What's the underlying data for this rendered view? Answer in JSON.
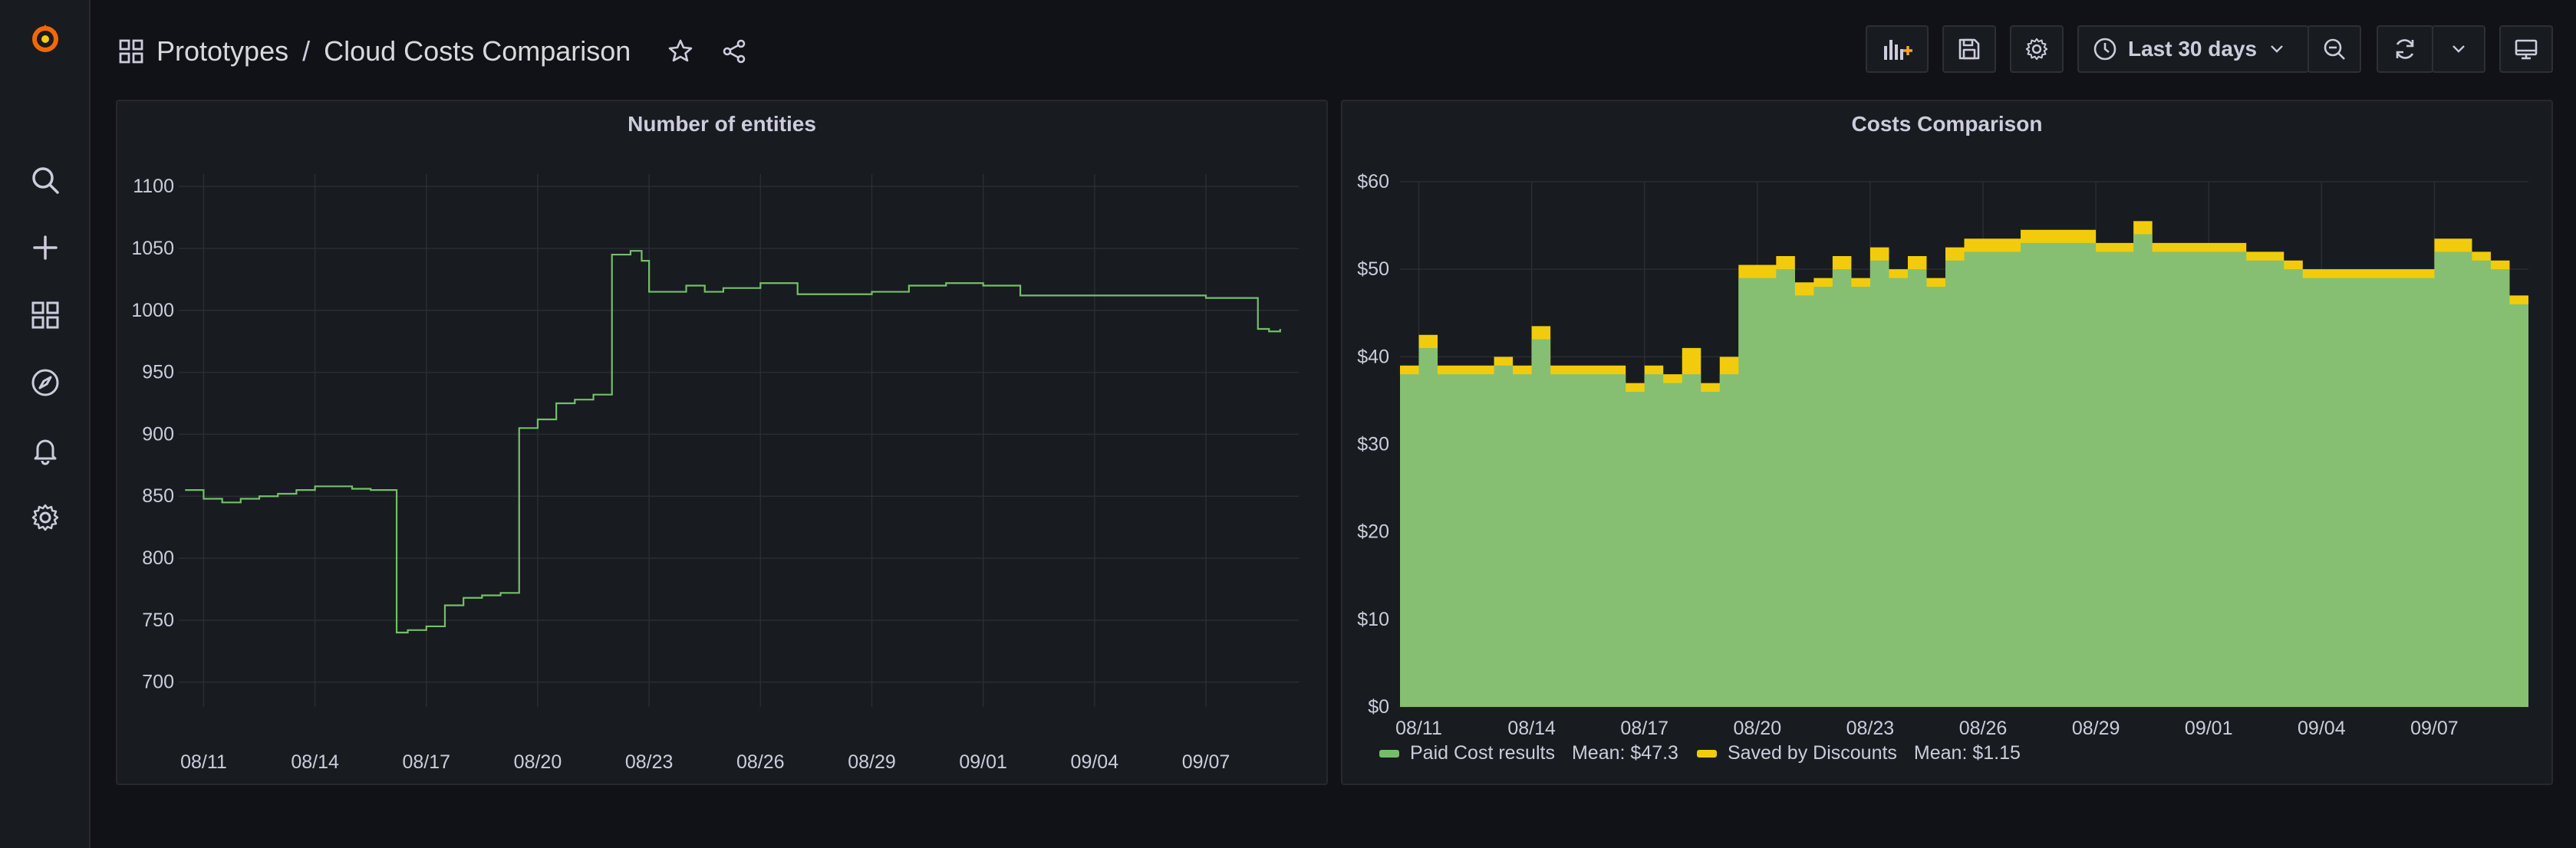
{
  "breadcrumb": {
    "folder": "Prototypes",
    "separator": "/",
    "dashboard": "Cloud Costs Comparison"
  },
  "toolbar": {
    "time_range": "Last 30 days"
  },
  "sidebar": {
    "items": [
      "grafana-logo-icon",
      "search-icon",
      "plus-icon",
      "dashboards-icon",
      "explore-icon",
      "alerting-bell-icon",
      "settings-gear-icon"
    ]
  },
  "colors": {
    "background": "#111217",
    "panel": "#181b1f",
    "green": "#73bf69",
    "area_green": "#86bf71",
    "yellow": "#f2cc0c",
    "logo": "#f46800"
  },
  "panels": [
    {
      "title": "Number of entities"
    },
    {
      "title": "Costs Comparison",
      "legend": [
        {
          "name": "Paid Cost results",
          "mean": "Mean: $47.3",
          "color": "#73bf69"
        },
        {
          "name": "Saved by Discounts",
          "mean": "Mean: $1.15",
          "color": "#f2cc0c"
        }
      ]
    }
  ],
  "chart_data": [
    {
      "type": "line",
      "title": "Number of entities",
      "x_ticks": [
        "08/11",
        "08/14",
        "08/17",
        "08/20",
        "08/23",
        "08/26",
        "08/29",
        "09/01",
        "09/04",
        "09/07"
      ],
      "y_ticks": [
        700,
        750,
        800,
        850,
        900,
        950,
        1000,
        1050,
        1100
      ],
      "ylim": [
        680,
        1110
      ],
      "xlim": [
        "08/10 08:00",
        "09/09 12:00"
      ],
      "grid": true,
      "series": [
        {
          "color": "#73bf69",
          "x_days": [
            10.5,
            11,
            11.5,
            12,
            12.5,
            13,
            13.5,
            14,
            14.5,
            15,
            15.5,
            16,
            16.2,
            16.5,
            17,
            17.5,
            18,
            18.5,
            19,
            19.5,
            20,
            20.5,
            21,
            21.5,
            22,
            22.5,
            22.8,
            23,
            23.5,
            24,
            24.5,
            25,
            26,
            27,
            28,
            29,
            30,
            31,
            32,
            33,
            34,
            35,
            36,
            37,
            38,
            39,
            39.4,
            39.7,
            40
          ],
          "y": [
            855,
            848,
            845,
            848,
            850,
            852,
            855,
            858,
            858,
            856,
            855,
            855,
            740,
            742,
            745,
            762,
            768,
            770,
            772,
            905,
            912,
            925,
            928,
            932,
            1045,
            1048,
            1040,
            1015,
            1015,
            1020,
            1015,
            1018,
            1022,
            1013,
            1013,
            1015,
            1020,
            1022,
            1020,
            1012,
            1012,
            1012,
            1012,
            1012,
            1010,
            1010,
            985,
            983,
            985
          ]
        }
      ]
    },
    {
      "type": "area",
      "title": "Costs Comparison",
      "x_ticks": [
        "08/11",
        "08/14",
        "08/17",
        "08/20",
        "08/23",
        "08/26",
        "08/29",
        "09/01",
        "09/04",
        "09/07"
      ],
      "y_ticks": [
        "$0",
        "$10",
        "$20",
        "$30",
        "$40",
        "$50",
        "$60"
      ],
      "ylim": [
        0,
        60
      ],
      "xlim": [
        "08/10 12:00",
        "09/09 12:00"
      ],
      "grid": true,
      "legend_position": "bottom",
      "series": [
        {
          "name": "Paid Cost results",
          "color": "#86bf71",
          "x_days": [
            10.5,
            11,
            11.5,
            12,
            12.5,
            13,
            13.5,
            14,
            14.5,
            15,
            15.5,
            16,
            16.5,
            17,
            17.5,
            18,
            18.5,
            19,
            19.5,
            20,
            20.5,
            21,
            21.5,
            22,
            22.5,
            23,
            23.5,
            24,
            24.5,
            25,
            25.5,
            26,
            27,
            28,
            29,
            30,
            30.5,
            31,
            32,
            33,
            34,
            34.5,
            35,
            36,
            37,
            38,
            39,
            39.5,
            40
          ],
          "y": [
            38,
            41,
            38,
            38,
            38,
            39,
            38,
            42,
            38,
            38,
            38,
            38,
            36,
            38,
            37,
            38,
            36,
            38,
            49,
            49,
            50,
            47,
            48,
            50,
            48,
            51,
            49,
            50,
            48,
            51,
            52,
            52,
            53,
            53,
            52,
            54,
            52,
            52,
            52,
            51,
            50,
            49,
            49,
            49,
            49,
            52,
            51,
            50,
            46
          ]
        },
        {
          "name": "Saved by Discounts",
          "color": "#f2cc0c",
          "x_days": [
            10.5,
            11,
            11.5,
            12,
            12.5,
            13,
            13.5,
            14,
            14.5,
            15,
            15.5,
            16,
            16.5,
            17,
            17.5,
            18,
            18.5,
            19,
            19.5,
            20,
            20.5,
            21,
            21.5,
            22,
            22.5,
            23,
            23.5,
            24,
            24.5,
            25,
            25.5,
            26,
            27,
            28,
            29,
            30,
            30.5,
            31,
            32,
            33,
            34,
            34.5,
            35,
            36,
            37,
            38,
            39,
            39.5,
            40
          ],
          "y": [
            1,
            1.5,
            1,
            1,
            1,
            1,
            1,
            1.5,
            1,
            1,
            1,
            1,
            1,
            1,
            1,
            3,
            1,
            2,
            1.5,
            1.5,
            1.5,
            1.5,
            1,
            1.5,
            1,
            1.5,
            1,
            1.5,
            1,
            1.5,
            1.5,
            1.5,
            1.5,
            1.5,
            1,
            1.5,
            1,
            1,
            1,
            1,
            1,
            1,
            1,
            1,
            1,
            1.5,
            1,
            1,
            1
          ]
        }
      ]
    }
  ]
}
